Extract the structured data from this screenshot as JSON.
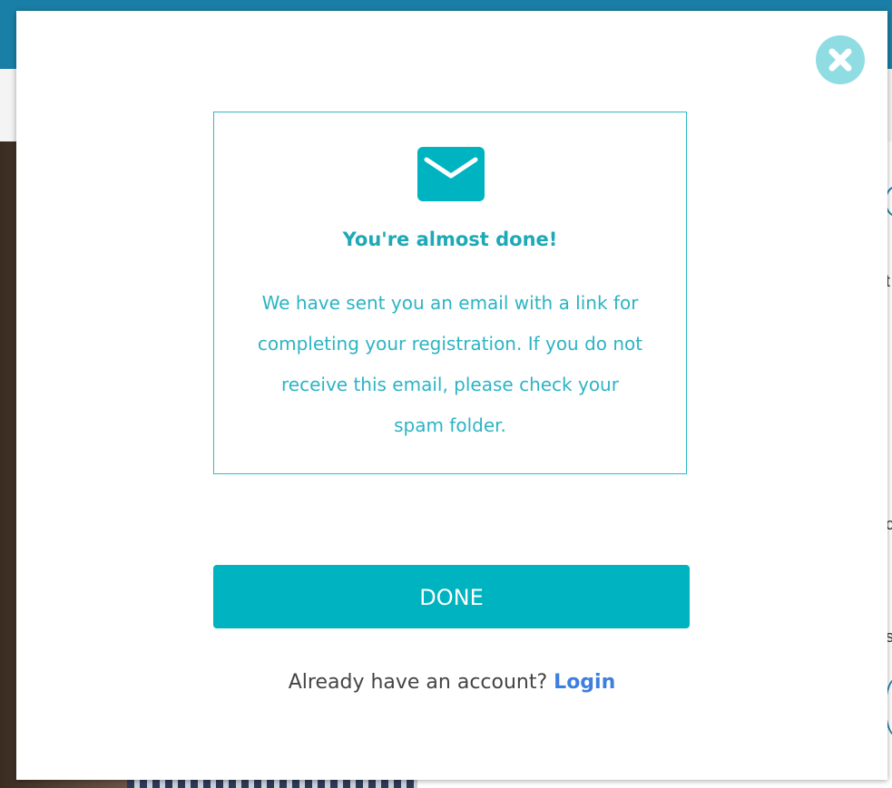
{
  "modal": {
    "title": "You're almost done!",
    "body_lines": [
      "We have sent you an email with a link for",
      "completing your registration. If you do not",
      "receive this email, please check your",
      "spam folder."
    ],
    "done_label": "DONE",
    "login_prompt": "Already have an account?",
    "login_label": "Login",
    "icons": {
      "close": "close-icon",
      "mail": "envelope-icon"
    }
  },
  "background": {
    "right_glyphs": [
      "t",
      "c",
      "s"
    ]
  },
  "colors": {
    "accent": "#00b3c0",
    "title": "#1da9b6",
    "body_text": "#2cb4c4",
    "close_bg": "#8fdde3",
    "link": "#3d7fe0",
    "topbar": "#1a7fa6"
  }
}
